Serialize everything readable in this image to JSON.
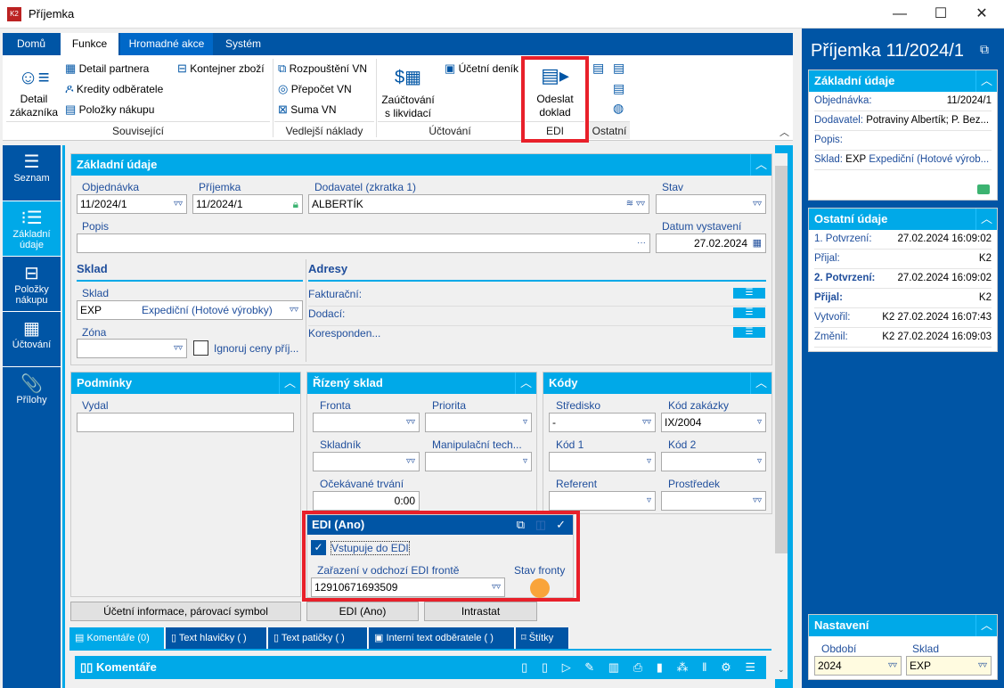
{
  "window": {
    "title": "Příjemka",
    "controls": [
      "—",
      "☐",
      "✕"
    ]
  },
  "ribbon": {
    "tabs": [
      "Domů",
      "Funkce",
      "Hromadné akce",
      "Systém"
    ],
    "active_tab": "Funkce",
    "groups": {
      "souvisejici": {
        "label": "Související",
        "detail_zakaznika": "Detail zákazníka",
        "detail_partnera": "Detail partnera",
        "kredity": "Kredity odběratele",
        "polozky": "Položky nákupu",
        "kontejner": "Kontejner zboží"
      },
      "vedlejsi": {
        "label": "Vedlejší náklady",
        "rozpousteni": "Rozpouštění VN",
        "prepocet": "Přepočet VN",
        "suma": "Suma VN"
      },
      "uctovani": {
        "label": "Účtování",
        "zauctovani": "Zaúčtování s likvidací",
        "denik": "Účetní deník"
      },
      "edi": {
        "label": "EDI",
        "odeslat": "Odeslat doklad"
      },
      "ostatni": {
        "label": "Ostatní"
      }
    }
  },
  "sidebar": {
    "items": [
      {
        "label": "Seznam",
        "icon": "list-icon"
      },
      {
        "label": "Základní údaje",
        "icon": "bullets-icon",
        "active": true
      },
      {
        "label": "Položky nákupu",
        "icon": "box-icon"
      },
      {
        "label": "Účtování",
        "icon": "calculator-icon"
      },
      {
        "label": "Přílohy",
        "icon": "paperclip-icon"
      }
    ]
  },
  "basic": {
    "title": "Základní údaje",
    "objednavka": {
      "label": "Objednávka",
      "value": "11/2024/1"
    },
    "prijemka": {
      "label": "Příjemka",
      "value": "11/2024/1"
    },
    "dodavatel": {
      "label": "Dodavatel (zkratka 1)",
      "value": "ALBERTÍK"
    },
    "stav": {
      "label": "Stav",
      "value": ""
    },
    "popis": {
      "label": "Popis",
      "value": "",
      "dots": "···"
    },
    "datum": {
      "label": "Datum vystavení",
      "value": "27.02.2024"
    },
    "sklad_sec": "Sklad",
    "sklad": {
      "label": "Sklad",
      "code": "EXP",
      "name": "Expediční (Hotové výrobky)"
    },
    "zona": {
      "label": "Zóna",
      "value": ""
    },
    "ignoruj": {
      "label": "Ignoruj ceny příj...",
      "checked": false
    },
    "adresy_sec": "Adresy",
    "adresy": [
      "Fakturační:",
      "Dodací:",
      "Koresponden..."
    ]
  },
  "podminky": {
    "title": "Podmínky",
    "vydal": "Vydal"
  },
  "rizeny": {
    "title": "Řízený sklad",
    "fronta": "Fronta",
    "priorita": "Priorita",
    "skladnik": "Skladník",
    "manip": "Manipulační tech...",
    "ocek": "Očekávané trvání",
    "ocek_value": "0:00"
  },
  "kody": {
    "title": "Kódy",
    "stredisko": "Středisko",
    "stredisko_value": "-",
    "zakazka": "Kód zakázky",
    "zakazka_value": "IX/2004",
    "kod1": "Kód 1",
    "kod2": "Kód 2",
    "referent": "Referent",
    "prostredek": "Prostředek"
  },
  "edi": {
    "title": "EDI (Ano)",
    "vstupuje": "Vstupuje do EDI",
    "vstupuje_checked": true,
    "zarazeni": "Zařazení v odchozí EDI frontě",
    "zarazeni_value": "12910671693509",
    "stav": "Stav fronty",
    "stav_color": "#f9a43a"
  },
  "buttons": {
    "ucetni": "Účetní informace, párovací symbol",
    "edi": "EDI (Ano)",
    "intrastat": "Intrastat"
  },
  "bottom_tabs": [
    "Komentáře (0)",
    "Text hlavičky ( )",
    "Text patičky ( )",
    "Interní text odběratele ( )",
    "Štítky"
  ],
  "komentare": {
    "title": "Komentáře"
  },
  "right": {
    "title": "Příjemka 11/2024/1",
    "zakladni": {
      "title": "Základní údaje",
      "objednavka_k": "Objednávka:",
      "objednavka_v": "11/2024/1",
      "dodavatel_k": "Dodavatel:",
      "dodavatel_v": "Potraviny Albertík; P. Bez...",
      "popis_k": "Popis:",
      "sklad_k": "Sklad:",
      "sklad_code": "EXP",
      "sklad_v": "Expediční (Hotové výrob..."
    },
    "ostatni": {
      "title": "Ostatní údaje",
      "rows": [
        {
          "k": "1. Potvrzení:",
          "v": "27.02.2024 16:09:02"
        },
        {
          "k": "Přijal:",
          "v": "K2"
        },
        {
          "k": "2. Potvrzení:",
          "v": "27.02.2024 16:09:02"
        },
        {
          "k": "Přijal:",
          "v": "K2"
        },
        {
          "k": "Vytvořil:",
          "v": "K2 27.02.2024 16:07:43"
        },
        {
          "k": "Změnil:",
          "v": "K2 27.02.2024 16:09:03"
        }
      ]
    },
    "nastaveni": {
      "title": "Nastavení",
      "obdobi": "Období",
      "obdobi_v": "2024",
      "sklad": "Sklad",
      "sklad_v": "EXP"
    }
  },
  "colors": {
    "dark_blue": "#0055a5",
    "light_blue": "#00a9e8",
    "highlight": "#e8202a",
    "lock": "#3cb371"
  }
}
